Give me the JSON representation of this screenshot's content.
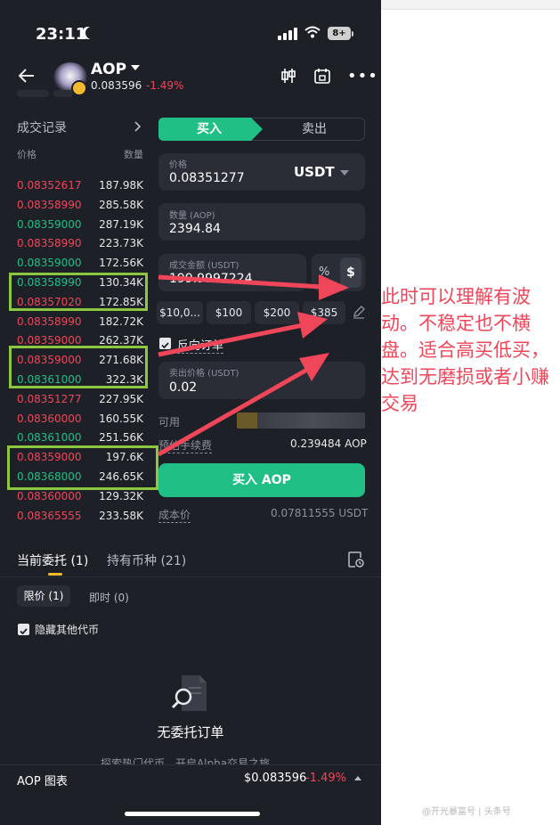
{
  "status_bar": {
    "time": "23:11",
    "battery": "8+"
  },
  "header": {
    "symbol": "AOP",
    "price": "0.083596",
    "change": "-1.49%"
  },
  "trade_history": {
    "title": "成交记录",
    "col_price": "价格",
    "col_qty": "数量",
    "rows": [
      {
        "price": "0.08352617",
        "qty": "187.98K",
        "side": "sell"
      },
      {
        "price": "0.08358990",
        "qty": "285.58K",
        "side": "sell"
      },
      {
        "price": "0.08359000",
        "qty": "287.19K",
        "side": "buy"
      },
      {
        "price": "0.08358990",
        "qty": "223.73K",
        "side": "sell"
      },
      {
        "price": "0.08359000",
        "qty": "172.56K",
        "side": "buy"
      },
      {
        "price": "0.08358990",
        "qty": "130.34K",
        "side": "buy"
      },
      {
        "price": "0.08357020",
        "qty": "172.85K",
        "side": "sell"
      },
      {
        "price": "0.08358990",
        "qty": "182.72K",
        "side": "sell"
      },
      {
        "price": "0.08359000",
        "qty": "262.37K",
        "side": "sell"
      },
      {
        "price": "0.08359000",
        "qty": "271.68K",
        "side": "sell"
      },
      {
        "price": "0.08361000",
        "qty": "322.3K",
        "side": "buy"
      },
      {
        "price": "0.08351277",
        "qty": "227.95K",
        "side": "sell"
      },
      {
        "price": "0.08360000",
        "qty": "160.55K",
        "side": "sell"
      },
      {
        "price": "0.08361000",
        "qty": "251.56K",
        "side": "buy"
      },
      {
        "price": "0.08359000",
        "qty": "197.6K",
        "side": "sell"
      },
      {
        "price": "0.08368000",
        "qty": "246.65K",
        "side": "buy"
      },
      {
        "price": "0.08360000",
        "qty": "129.32K",
        "side": "sell"
      },
      {
        "price": "0.08365555",
        "qty": "233.58K",
        "side": "sell"
      }
    ]
  },
  "order_form": {
    "tab_buy": "买入",
    "tab_sell": "卖出",
    "price_label": "价格",
    "price_value": "0.08351277",
    "quote_currency": "USDT",
    "qty_label": "数量 (AOP)",
    "qty_value": "2394.84",
    "amount_label": "成交金额 (USDT)",
    "amount_value": "199.9997224",
    "pct_symbol": "%",
    "usd_symbol": "$",
    "presets": [
      "$10,0...",
      "$100",
      "$200",
      "$385"
    ],
    "reverse_label": "反向订单",
    "sell_price_label": "卖出价格 (USDT)",
    "sell_price_value": "0.02",
    "available_label": "可用",
    "fee_label": "预估手续费",
    "fee_value": "0.239484 AOP",
    "buy_button": "买入 AOP",
    "cost_label": "成本价",
    "cost_value": "0.07811555 USDT"
  },
  "orders": {
    "tab_open": "当前委托 (1)",
    "tab_holdings": "持有币种 (21)",
    "sub_limit": "限价 (1)",
    "sub_instant": "即时 (0)",
    "hide_label": "隐藏其他代币",
    "empty_title": "无委托订单",
    "empty_sub": "探索热门代币，开启Alpha交易之旅。"
  },
  "footer": {
    "chart_label": "AOP 图表",
    "price": "$0.083596",
    "change": "-1.49%"
  },
  "annotation": {
    "text": "此时可以理解有波动。不稳定也不横盘。适合高买低买，达到无磨损或者小赚交易"
  },
  "watermark": "@开光暴富号 | 头条号",
  "colors": {
    "buy_green": "#1fbf86",
    "sell_red": "#f0465a",
    "annotation_red": "#f0465a",
    "highlight_green": "#8dc63f"
  }
}
